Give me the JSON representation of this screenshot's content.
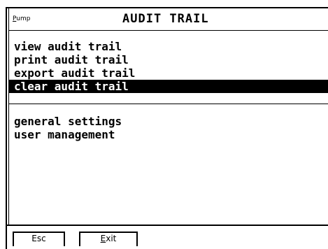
{
  "window": {
    "app_label_first": "P",
    "app_label_rest": "ump",
    "title": "AUDIT TRAIL"
  },
  "menu": {
    "items": [
      {
        "label": "view audit trail"
      },
      {
        "label": "print audit trail"
      },
      {
        "label": "export audit trail"
      },
      {
        "label": "clear audit trail",
        "selected": true
      }
    ]
  },
  "menu2": {
    "items": [
      {
        "label": "general settings"
      },
      {
        "label": "user management"
      }
    ]
  },
  "footer": {
    "esc_label": "Esc",
    "exit_label_first": "E",
    "exit_label_rest": "xit"
  }
}
